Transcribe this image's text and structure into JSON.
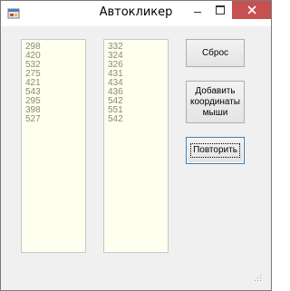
{
  "window": {
    "title": "Автокликер",
    "colors": {
      "close_button": "#c75050",
      "list_background": "#fffff0",
      "list_text": "#8a8a70"
    }
  },
  "lists": {
    "left": [
      "298",
      "420",
      "532",
      "275",
      "421",
      "543",
      "295",
      "398",
      "527"
    ],
    "right": [
      "332",
      "324",
      "326",
      "431",
      "434",
      "436",
      "542",
      "551",
      "542"
    ]
  },
  "buttons": {
    "reset": "Сброс",
    "add_mouse_coords": "Добавить\nкоординаты\nмыши",
    "repeat": "Повторить"
  },
  "icons": {
    "app": "app-icon",
    "minimize": "minimize-icon",
    "maximize": "maximize-icon",
    "close": "close-icon"
  }
}
